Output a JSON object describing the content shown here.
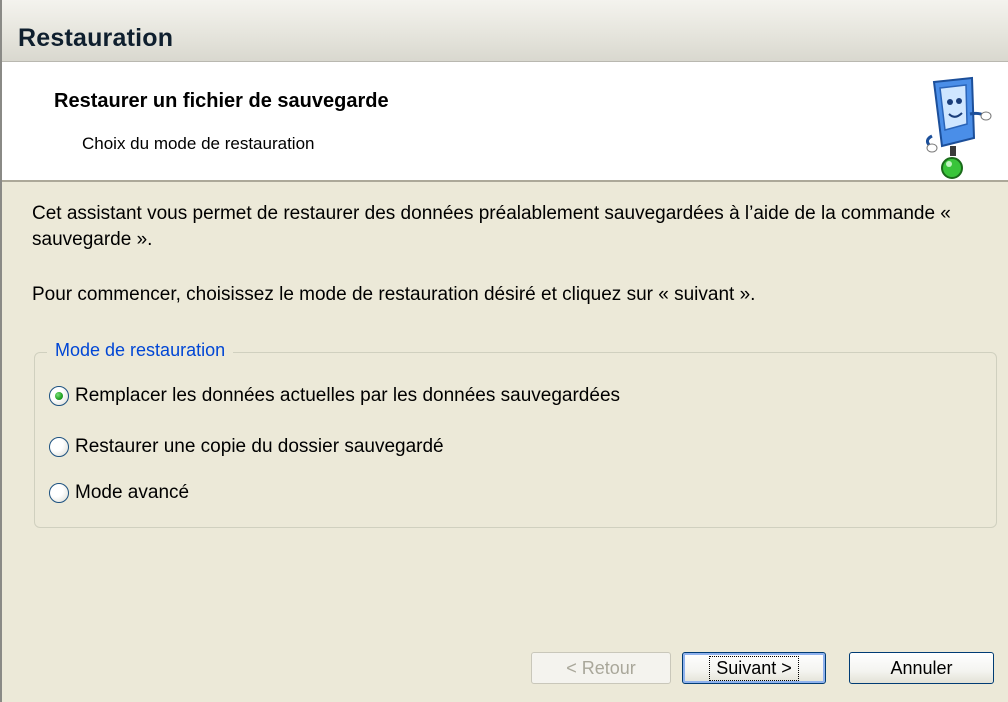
{
  "window": {
    "title": "Restauration"
  },
  "header": {
    "title": "Restaurer un fichier de sauvegarde",
    "subtitle": "Choix du mode de restauration",
    "logo_icon": "computer-mascot-icon"
  },
  "content": {
    "intro": "Cet assistant vous permet de restaurer des données préalablement sauvegardées à l’aide de la commande « sauvegarde ».",
    "instruction": "Pour commencer, choisissez le mode de restauration désiré et cliquez sur « suivant »."
  },
  "mode_group": {
    "legend": "Mode de restauration",
    "options": [
      {
        "label": "Remplacer les données actuelles par les données sauvegardées",
        "checked": true
      },
      {
        "label": "Restaurer une copie du dossier sauvegardé",
        "checked": false
      },
      {
        "label": "Mode avancé",
        "checked": false
      }
    ]
  },
  "buttons": {
    "back_label": "< Retour",
    "next_label": "Suivant >",
    "cancel_label": "Annuler"
  },
  "colors": {
    "legend": "#0046d5",
    "dialog_background": "#ece9d8",
    "radio_selected": "#21a121"
  }
}
